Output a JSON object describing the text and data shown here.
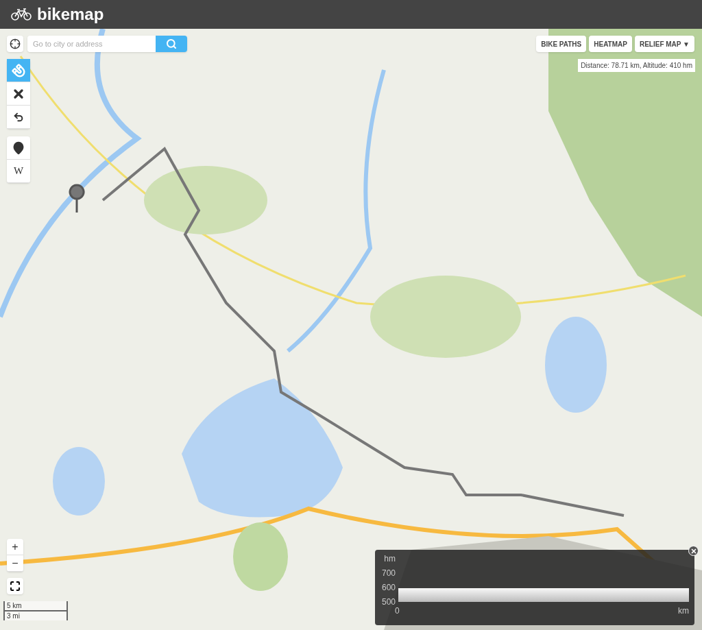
{
  "header": {
    "logo_text": "bikemap"
  },
  "search": {
    "placeholder": "Go to city or address"
  },
  "tools": [
    {
      "kind": "magnet",
      "selected": true
    },
    {
      "kind": "close",
      "selected": false
    },
    {
      "kind": "undo",
      "selected": false
    }
  ],
  "extra_tools": [
    {
      "kind": "pin"
    },
    {
      "kind": "wiki",
      "label": "W"
    }
  ],
  "layer_buttons": [
    {
      "label": "BIKE PATHS"
    },
    {
      "label": "HEATMAP"
    },
    {
      "label": "RELIEF MAP ▼"
    }
  ],
  "route_info": "Distance: 78.71 km, Altitude: 410 hm",
  "zoom_buttons": [
    "+",
    "−"
  ],
  "scale": [
    "5 km",
    "3 mi"
  ],
  "elevation": {
    "y_unit": "hm",
    "y_labels": [
      "700",
      "600",
      "500"
    ],
    "x_start": "0",
    "x_unit": "km"
  }
}
